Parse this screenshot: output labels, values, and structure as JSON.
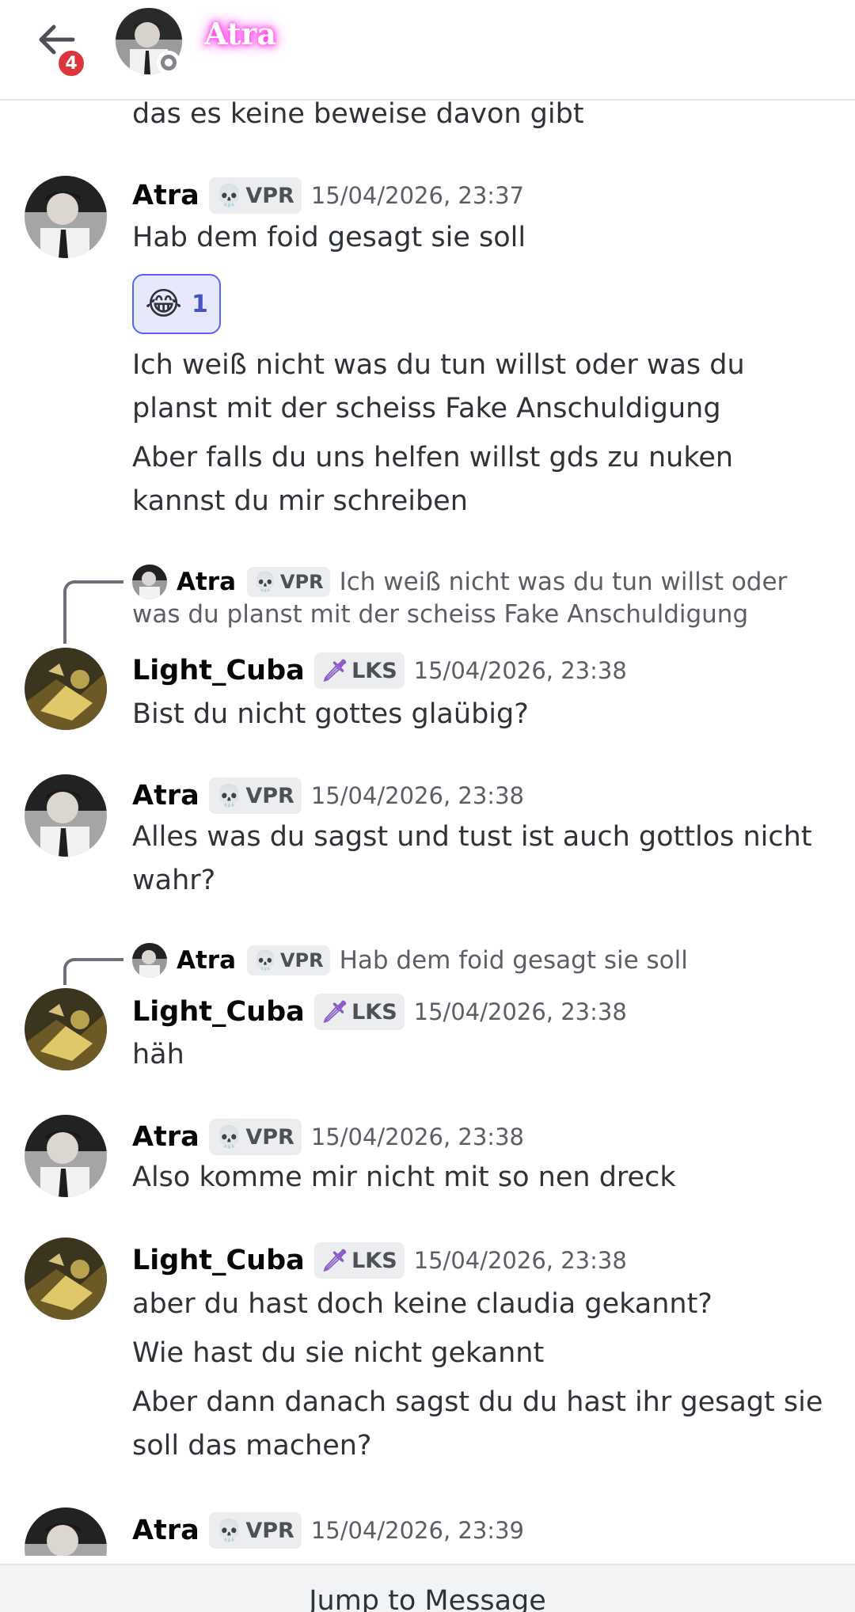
{
  "header": {
    "unread_badge": "4",
    "title": "Atra",
    "icons": {
      "back": "back-arrow-icon",
      "status": "offline-status-icon"
    }
  },
  "top_partial_text": "das es keine beweise davon gibt",
  "messages": [
    {
      "author": "Atra",
      "tag": "VPR",
      "tag_icon": "skull-icon",
      "timestamp": "15/04/2026, 23:37",
      "lines": [
        "Hab dem foid gesagt sie soll"
      ],
      "reaction": {
        "emoji": "😂",
        "count": "1"
      },
      "extra_lines": [
        "Ich weiß nicht was du tun willst oder was du",
        "planst mit der scheiss Fake Anschuldigung",
        "Aber falls du uns helfen willst gds zu nuken",
        "kannst du mir schreiben"
      ]
    },
    {
      "reply_to": {
        "author": "Atra",
        "tag": "VPR",
        "text_line1": "Ich weiß nicht was du tun willst oder",
        "text_line2": "was du planst mit der scheiss Fake Anschuldigung"
      },
      "author": "Light_Cuba",
      "tag": "LKS",
      "tag_icon": "sword-icon",
      "timestamp": "15/04/2026, 23:38",
      "lines": [
        "Bist du nicht gottes glaübig?"
      ]
    },
    {
      "author": "Atra",
      "tag": "VPR",
      "timestamp": "15/04/2026, 23:38",
      "lines": [
        "Alles was du sagst und tust ist auch gottlos nicht",
        "wahr?"
      ]
    },
    {
      "reply_to": {
        "author": "Atra",
        "tag": "VPR",
        "text_line1": "Hab dem foid gesagt sie soll"
      },
      "author": "Light_Cuba",
      "tag": "LKS",
      "timestamp": "15/04/2026, 23:38",
      "lines": [
        "häh"
      ]
    },
    {
      "author": "Atra",
      "tag": "VPR",
      "timestamp": "15/04/2026, 23:38",
      "lines": [
        "Also komme mir nicht mit so nen dreck"
      ]
    },
    {
      "author": "Light_Cuba",
      "tag": "LKS",
      "timestamp": "15/04/2026, 23:38",
      "lines": [
        "aber du hast doch keine claudia gekannt?",
        "Wie hast du sie nicht gekannt",
        "Aber dann danach sagst du du hast ihr gesagt sie",
        "soll das machen?"
      ]
    },
    {
      "author": "Atra",
      "tag": "VPR",
      "timestamp": "15/04/2026, 23:39",
      "lines": []
    }
  ],
  "jump_button": "Jump to Message",
  "colors": {
    "accent": "#5865f2",
    "badge": "#da373c",
    "name_glow": "#ff2ee6"
  }
}
